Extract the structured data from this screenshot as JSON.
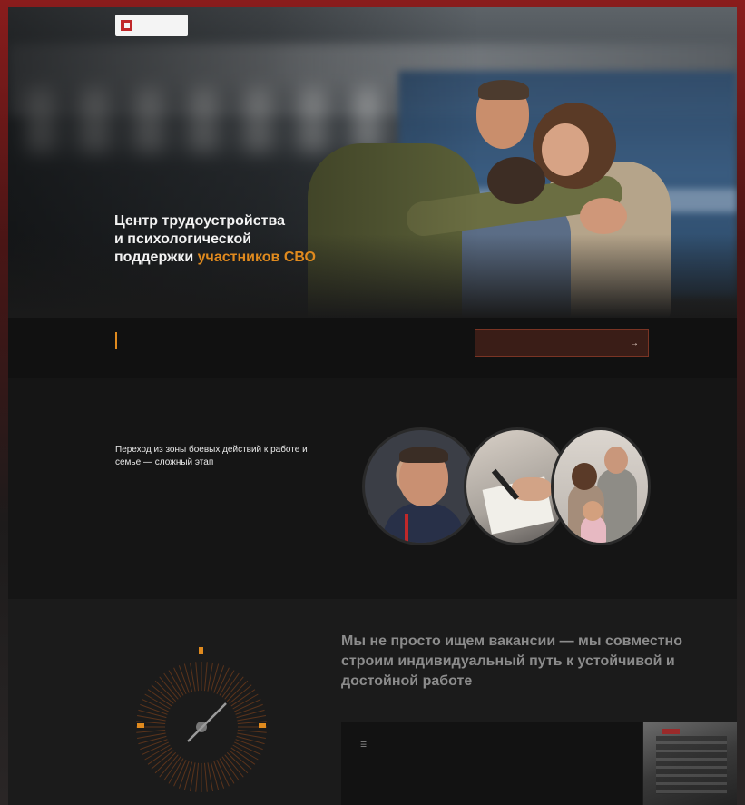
{
  "nav": {
    "logo_text": "",
    "links": [
      {
        "label": ""
      },
      {
        "label": ""
      },
      {
        "label": ""
      }
    ],
    "city": ""
  },
  "hero": {
    "title_line1": "Центр трудоустройства",
    "title_line2": "и психологической",
    "title_line3_plain": "поддержки ",
    "title_line3_accent": "участников СВО",
    "subtitle": ""
  },
  "strip": {
    "text_accent": "",
    "text": "",
    "cta_label": "",
    "cta_arrow": "→"
  },
  "section2": {
    "eyebrow": "",
    "title": "Переход из зоны боевых действий к работе и семье — сложный этап",
    "paragraph1": "",
    "paragraph2": ""
  },
  "section3": {
    "title": "Мы не просто ищем вакансии — мы совместно строим индивидуальный путь к устойчивой и достойной работе",
    "panel_icon": "☰"
  },
  "colors": {
    "accent": "#e08a1e",
    "brand_red": "#c0282a",
    "background": "#161616"
  }
}
